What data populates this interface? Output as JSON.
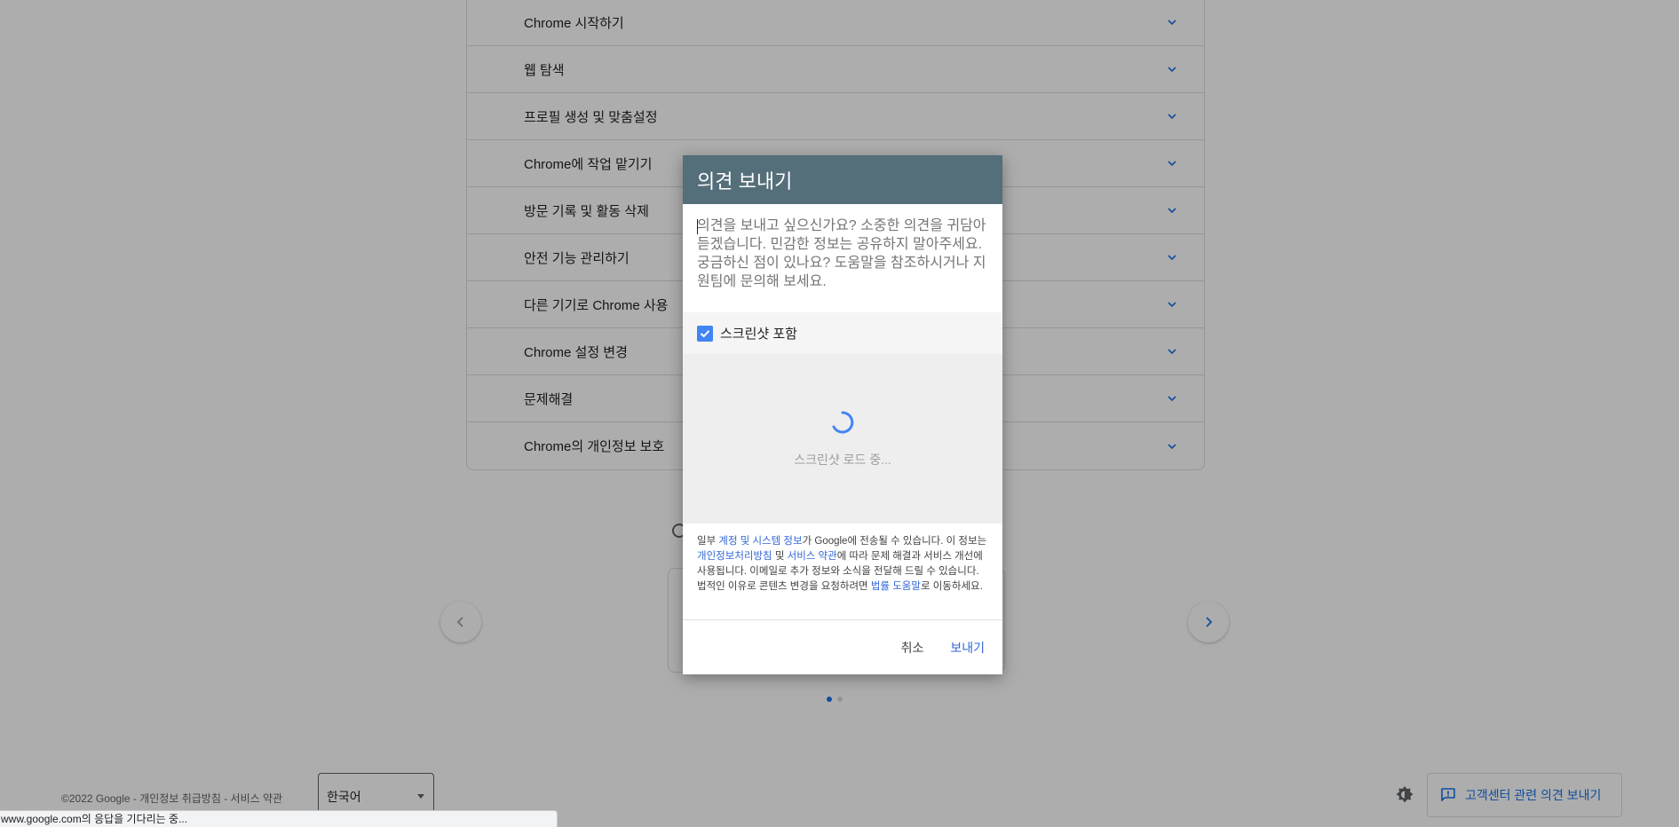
{
  "accordion": {
    "items": [
      {
        "label": "Chrome 시작하기"
      },
      {
        "label": "웹 탐색"
      },
      {
        "label": "프로필 생성 및 맞춤설정"
      },
      {
        "label": "Chrome에 작업 맡기기"
      },
      {
        "label": "방문 기록 및 활동 삭제"
      },
      {
        "label": "안전 기능 관리하기"
      },
      {
        "label": "다른 기기로 Chrome 사용"
      },
      {
        "label": "Chrome 설정 변경"
      },
      {
        "label": "문제해결"
      },
      {
        "label": "Chrome의 개인정보 보호"
      }
    ]
  },
  "footer": {
    "links": "©2022 Google - 개인정보 취급방침 - 서비스 약관",
    "language": "한국어",
    "feedback_label": "고객센터 관련 의견 보내기"
  },
  "statusbar": {
    "text": "www.google.com의 응답을 기다리는 중..."
  },
  "dialog": {
    "title": "의견 보내기",
    "placeholder": "의견을 보내고 싶으신가요? 소중한 의견을 귀담아 듣겠습니다. 민감한 정보는 공유하지 말아주세요. 궁금하신 점이 있나요? 도움말을 참조하시거나 지원팀에 문의해 보세요.",
    "screenshot_label": "스크린샷 포함",
    "screenshot_checked": true,
    "loading_text": "스크린샷 로드 중...",
    "legal": {
      "p1": "일부 ",
      "link_account": "계정 및 시스템 정보",
      "p2": "가 Google에 전송될 수 있습니다. 이 정보는 ",
      "link_privacy": "개인정보처리방침",
      "p3": " 및 ",
      "link_terms": "서비스 약관",
      "p4": "에 따라 문제 해결과 서비스 개선에 사용됩니다. 이메일로 추가 정보와 소식을 전달해 드릴 수 있습니다. 법적인 이유로 콘텐츠 변경을 요청하려면 ",
      "link_legal": "법률 도움말",
      "p5": "로 이동하세요."
    },
    "cancel_label": "취소",
    "send_label": "보내기"
  },
  "colors": {
    "header_bg": "#546e7a",
    "link": "#3367d6",
    "accent": "#1a73e8",
    "checkbox": "#4285f4"
  }
}
